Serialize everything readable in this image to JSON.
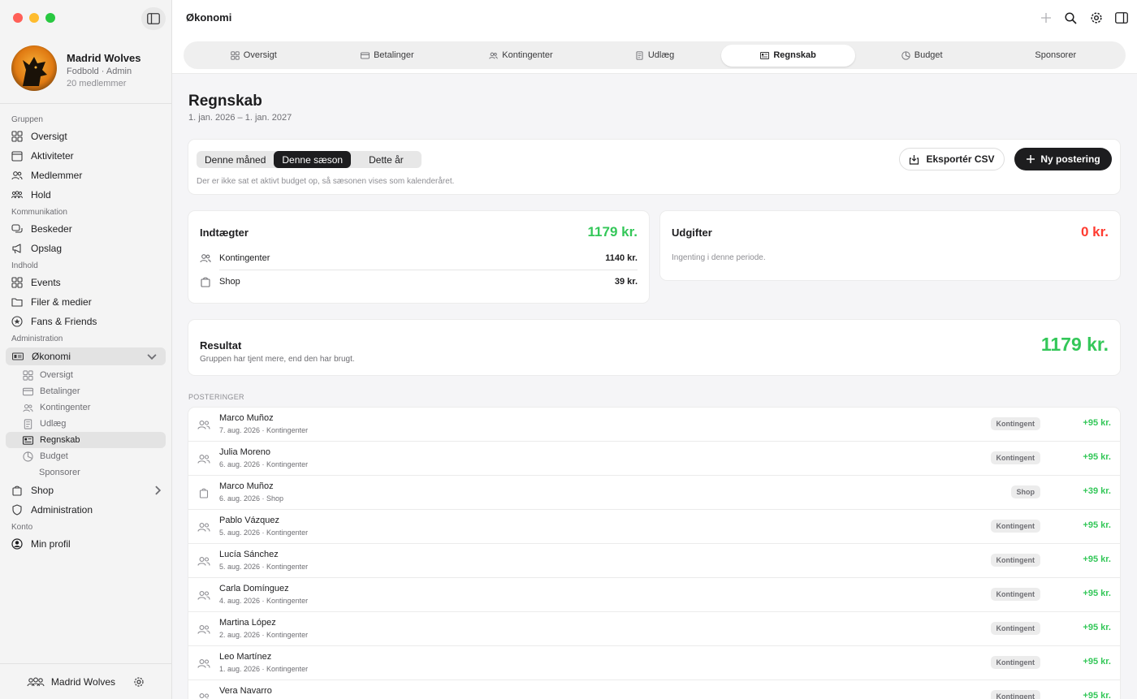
{
  "window": {
    "title": "Økonomi"
  },
  "profile": {
    "name": "Madrid Wolves",
    "subtitle": "Fodbold · Admin",
    "members": "20 medlemmer"
  },
  "sidebar": {
    "sections": {
      "gruppen": "Gruppen",
      "kommunikation": "Kommunikation",
      "indhold": "Indhold",
      "administration": "Administration",
      "konto": "Konto"
    },
    "items": {
      "oversigt": "Oversigt",
      "aktiviteter": "Aktiviteter",
      "medlemmer": "Medlemmer",
      "hold": "Hold",
      "beskeder": "Beskeder",
      "opslag": "Opslag",
      "events": "Events",
      "filer": "Filer & medier",
      "fans": "Fans & Friends",
      "okonomi": "Økonomi",
      "shop": "Shop",
      "administration": "Administration",
      "minprofil": "Min profil"
    },
    "sub_items": {
      "oversigt": "Oversigt",
      "betalinger": "Betalinger",
      "kontingenter": "Kontingenter",
      "udlaeg": "Udlæg",
      "regnskab": "Regnskab",
      "budget": "Budget",
      "sponsorer": "Sponsorer"
    },
    "footer": {
      "team": "Madrid Wolves"
    }
  },
  "tabs": {
    "oversigt": "Oversigt",
    "betalinger": "Betalinger",
    "kontingenter": "Kontingenter",
    "udlaeg": "Udlæg",
    "regnskab": "Regnskab",
    "budget": "Budget",
    "sponsorer": "Sponsorer",
    "active": "Regnskab"
  },
  "page": {
    "title": "Regnskab",
    "period": "1. jan. 2026 – 1. jan. 2027"
  },
  "period_selector": {
    "options": {
      "month": "Denne måned",
      "season": "Denne sæson",
      "year": "Dette år"
    },
    "selected": "Denne sæson",
    "note": "Der er ikke sat et aktivt budget op, så sæsonen vises som kalenderåret."
  },
  "actions": {
    "export": "Eksportér CSV",
    "new_entry": "Ny postering"
  },
  "income": {
    "title": "Indtægter",
    "total": "1179 kr.",
    "rows": [
      {
        "label": "Kontingenter",
        "value": "1140 kr.",
        "icon": "people-icon"
      },
      {
        "label": "Shop",
        "value": "39 kr.",
        "icon": "bag-icon"
      }
    ]
  },
  "expenses": {
    "title": "Udgifter",
    "total": "0 kr.",
    "empty": "Ingenting i denne periode."
  },
  "result": {
    "title": "Resultat",
    "subtitle": "Gruppen har tjent mere, end den har brugt.",
    "amount": "1179 kr."
  },
  "postings": {
    "label": "POSTERINGER",
    "rows": [
      {
        "name": "Marco Muñoz",
        "meta": "7. aug. 2026 · Kontingenter",
        "tag": "Kontingent",
        "amount": "+95 kr.",
        "icon": "people-icon"
      },
      {
        "name": "Julia Moreno",
        "meta": "6. aug. 2026 · Kontingenter",
        "tag": "Kontingent",
        "amount": "+95 kr.",
        "icon": "people-icon"
      },
      {
        "name": "Marco Muñoz",
        "meta": "6. aug. 2026 · Shop",
        "tag": "Shop",
        "amount": "+39 kr.",
        "icon": "bag-icon"
      },
      {
        "name": "Pablo Vázquez",
        "meta": "5. aug. 2026 · Kontingenter",
        "tag": "Kontingent",
        "amount": "+95 kr.",
        "icon": "people-icon"
      },
      {
        "name": "Lucía Sánchez",
        "meta": "5. aug. 2026 · Kontingenter",
        "tag": "Kontingent",
        "amount": "+95 kr.",
        "icon": "people-icon"
      },
      {
        "name": "Carla Domínguez",
        "meta": "4. aug. 2026 · Kontingenter",
        "tag": "Kontingent",
        "amount": "+95 kr.",
        "icon": "people-icon"
      },
      {
        "name": "Martina López",
        "meta": "2. aug. 2026 · Kontingenter",
        "tag": "Kontingent",
        "amount": "+95 kr.",
        "icon": "people-icon"
      },
      {
        "name": "Leo Martínez",
        "meta": "1. aug. 2026 · Kontingenter",
        "tag": "Kontingent",
        "amount": "+95 kr.",
        "icon": "people-icon"
      },
      {
        "name": "Vera Navarro",
        "meta": "",
        "tag": "Kontingent",
        "amount": "+95 kr.",
        "icon": "people-icon"
      }
    ]
  },
  "colors": {
    "positive": "#34c759",
    "negative": "#ff3b30",
    "dark": "#1d1d1f"
  }
}
